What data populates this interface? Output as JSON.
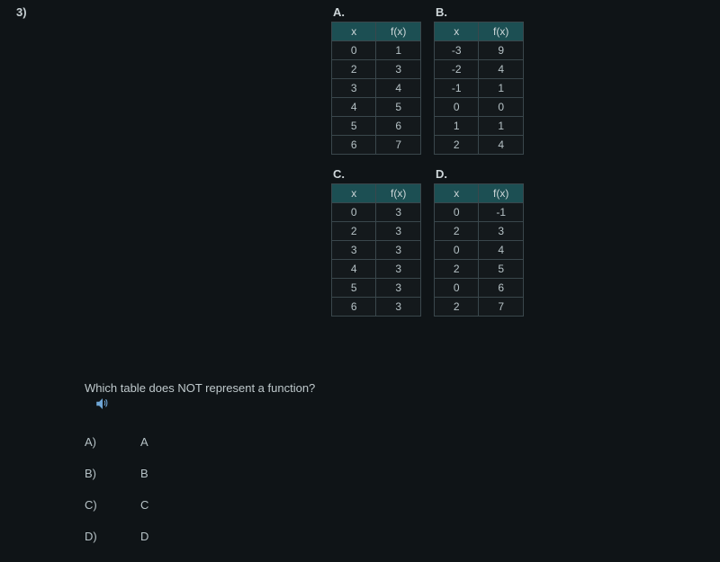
{
  "question_number": "3)",
  "tables": {
    "A": {
      "label": "A.",
      "header": [
        "x",
        "f(x)"
      ],
      "rows": [
        [
          "0",
          "1"
        ],
        [
          "2",
          "3"
        ],
        [
          "3",
          "4"
        ],
        [
          "4",
          "5"
        ],
        [
          "5",
          "6"
        ],
        [
          "6",
          "7"
        ]
      ]
    },
    "B": {
      "label": "B.",
      "header": [
        "x",
        "f(x)"
      ],
      "rows": [
        [
          "-3",
          "9"
        ],
        [
          "-2",
          "4"
        ],
        [
          "-1",
          "1"
        ],
        [
          "0",
          "0"
        ],
        [
          "1",
          "1"
        ],
        [
          "2",
          "4"
        ]
      ]
    },
    "C": {
      "label": "C.",
      "header": [
        "x",
        "f(x)"
      ],
      "rows": [
        [
          "0",
          "3"
        ],
        [
          "2",
          "3"
        ],
        [
          "3",
          "3"
        ],
        [
          "4",
          "3"
        ],
        [
          "5",
          "3"
        ],
        [
          "6",
          "3"
        ]
      ]
    },
    "D": {
      "label": "D.",
      "header": [
        "x",
        "f(x)"
      ],
      "rows": [
        [
          "0",
          "-1"
        ],
        [
          "2",
          "3"
        ],
        [
          "0",
          "4"
        ],
        [
          "2",
          "5"
        ],
        [
          "0",
          "6"
        ],
        [
          "2",
          "7"
        ]
      ]
    }
  },
  "prompt": "Which table does NOT represent a function?",
  "icons": {
    "speaker": "speaker-icon"
  },
  "choices": [
    {
      "key": "A)",
      "value": "A"
    },
    {
      "key": "B)",
      "value": "B"
    },
    {
      "key": "C)",
      "value": "C"
    },
    {
      "key": "D)",
      "value": "D"
    }
  ]
}
